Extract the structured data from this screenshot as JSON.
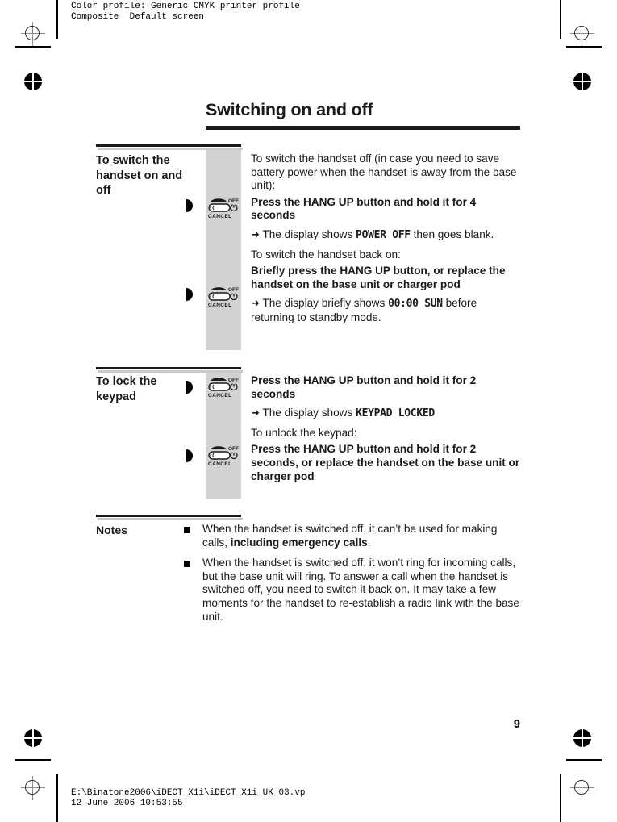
{
  "prepress": {
    "header_line1": "Color profile: Generic CMYK printer profile",
    "header_line2": "Composite  Default screen",
    "footer_line1": "E:\\Binatone2006\\iDECT_X1i\\iDECT_X1i_UK_03.vp",
    "footer_line2": "12 June 2006 10:53:55"
  },
  "page": {
    "title": "Switching on and off",
    "number": "9"
  },
  "sections": [
    {
      "heading": "To switch the handset on and off",
      "icon_labels": {
        "off": "OFF",
        "cancel": "CANCEL"
      },
      "blocks": [
        {
          "style": "regular",
          "text": "To switch the handset off (in case you need to save battery power when the handset is away from the base unit):"
        },
        {
          "style": "bold",
          "text_pre": "Press the ",
          "text_key": "HANG UP",
          "text_post": " button and hold it for 4 seconds"
        },
        {
          "style": "result",
          "arrow": "➜",
          "text_pre": "The display shows ",
          "lcd": "POWER OFF",
          "text_post": " then goes blank."
        },
        {
          "style": "regular",
          "text": "To switch the handset back on:"
        },
        {
          "style": "bold",
          "text_pre": "Briefly press the ",
          "text_key": "HANG UP",
          "text_post": " button, or replace the handset on the base unit or charger pod"
        },
        {
          "style": "result",
          "arrow": "➜",
          "text_pre": "The display briefly shows ",
          "lcd": "00:00 SUN",
          "text_post": " before returning to standby mode."
        }
      ]
    },
    {
      "heading": "To lock the keypad",
      "icon_labels": {
        "off": "OFF",
        "cancel": "CANCEL"
      },
      "blocks": [
        {
          "style": "bold",
          "text_pre": "Press the ",
          "text_key": "HANG UP",
          "text_post": " button and hold it for 2 seconds"
        },
        {
          "style": "result",
          "arrow": "➜",
          "text_pre": "The display shows ",
          "lcd": "KEYPAD LOCKED",
          "text_post": ""
        },
        {
          "style": "regular",
          "text": "To unlock the keypad:"
        },
        {
          "style": "bold",
          "text_pre": "Press the ",
          "text_key": "HANG UP",
          "text_post": " button and hold it for 2 seconds, or replace the handset on the base unit or charger pod"
        }
      ]
    }
  ],
  "notes": {
    "label": "Notes",
    "items": [
      {
        "text_pre": "When the handset is switched off, it can’t be used for making calls, ",
        "bold": "including emergency calls",
        "text_post": "."
      },
      {
        "text_pre": "When the handset is switched off, it won’t ring for incoming calls, but the base unit will ring. To answer a call when the handset is switched off, you need to switch it back on. It may take a few moments for the handset to re-establish a radio link with the base unit.",
        "bold": "",
        "text_post": ""
      }
    ]
  }
}
